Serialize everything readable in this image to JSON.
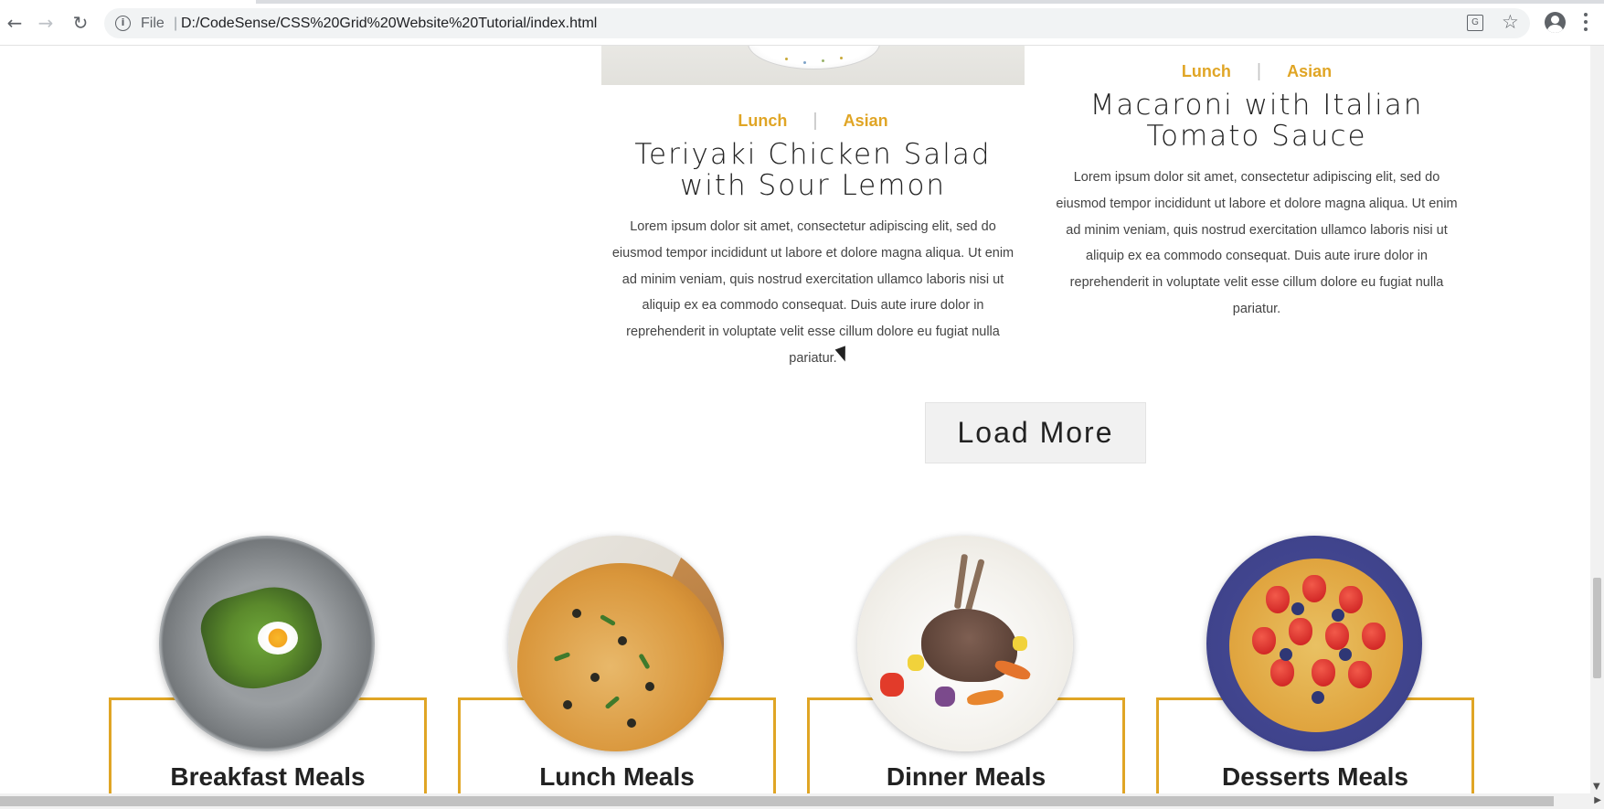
{
  "browser": {
    "file_label": "File",
    "separator": "|",
    "url": "D:/CodeSense/CSS%20Grid%20Website%20Tutorial/index.html"
  },
  "recipes": [
    {
      "tag1": "Lunch",
      "tag_separator": "|",
      "tag2": "Asian",
      "title": "Teriyaki Chicken Salad with Sour Lemon",
      "text": "Lorem ipsum dolor sit amet, consectetur adipiscing elit, sed do eiusmod tempor incididunt ut labore et dolore magna aliqua. Ut enim ad minim veniam, quis nostrud exercitation ullamco laboris nisi ut aliquip ex ea commodo consequat. Duis aute irure dolor in reprehenderit in voluptate velit esse cillum dolore eu fugiat nulla pariatur."
    },
    {
      "tag1": "Lunch",
      "tag_separator": "|",
      "tag2": "Asian",
      "title": "Macaroni with Italian Tomato Sauce",
      "text": "Lorem ipsum dolor sit amet, consectetur adipiscing elit, sed do eiusmod tempor incididunt ut labore et dolore magna aliqua. Ut enim ad minim veniam, quis nostrud exercitation ullamco laboris nisi ut aliquip ex ea commodo consequat. Duis aute irure dolor in reprehenderit in voluptate velit esse cillum dolore eu fugiat nulla pariatur."
    }
  ],
  "load_more_label": "Load More",
  "meal_categories": [
    {
      "name": "Breakfast Meals"
    },
    {
      "name": "Lunch Meals"
    },
    {
      "name": "Dinner Meals"
    },
    {
      "name": "Desserts Meals"
    }
  ],
  "colors": {
    "accent": "#e0a525",
    "button_bg": "#f1f1f1",
    "text_dark": "#222222"
  },
  "icons": [
    "back-arrow-icon",
    "forward-arrow-icon",
    "reload-icon",
    "info-icon",
    "translate-icon",
    "star-icon",
    "account-icon",
    "menu-icon"
  ]
}
